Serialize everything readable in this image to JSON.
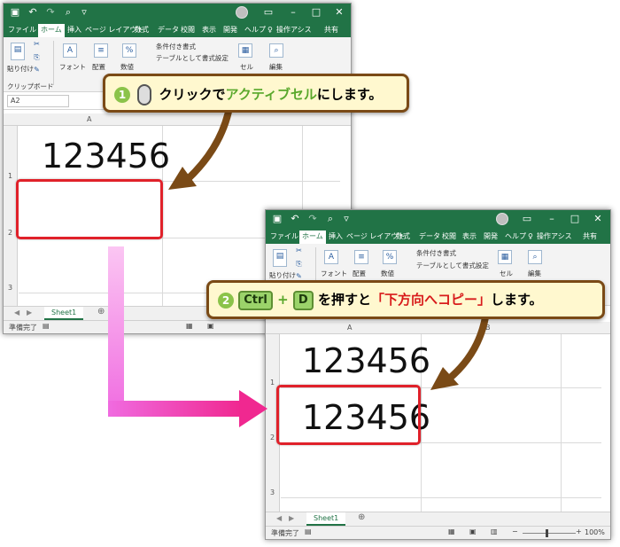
{
  "back_window": {
    "tabs": [
      "ファイル",
      "ホーム",
      "挿入",
      "ページ レイアウト",
      "数式",
      "データ",
      "校閲",
      "表示",
      "開発",
      "ヘルプ",
      "操作アシス",
      "共有"
    ],
    "ribbon": {
      "paste": "貼り付け",
      "font": "フォント",
      "align": "配置",
      "number": "数値",
      "cond_format": "条件付き書式",
      "table_format": "テーブルとして書式設定",
      "cells": "セル",
      "edit": "編集",
      "clipboard": "クリップボード"
    },
    "name_box": "A2",
    "col_a": "A",
    "rows": [
      "1",
      "2",
      "3"
    ],
    "a1_value": "123456",
    "sheet_tab": "Sheet1",
    "status": "準備完了"
  },
  "front_window": {
    "tabs": [
      "ファイル",
      "ホーム",
      "挿入",
      "ページ レイアウト",
      "数式",
      "データ",
      "校閲",
      "表示",
      "開発",
      "ヘルプ",
      "操作アシス",
      "共有"
    ],
    "ribbon": {
      "paste": "貼り付け",
      "font": "フォント",
      "align": "配置",
      "number": "数値",
      "cond_format": "条件付き書式",
      "table_format": "テーブルとして書式設定",
      "cells": "セル",
      "edit": "編集"
    },
    "col_a": "A",
    "col_b": "B",
    "rows": [
      "1",
      "2",
      "3"
    ],
    "a1_value": "123456",
    "a2_value": "123456",
    "sheet_tab": "Sheet1",
    "status": "準備完了",
    "zoom": "100%"
  },
  "callout1": {
    "num": "1",
    "t1": "クリックで",
    "t2": "アクティブセル",
    "t3": "にします。"
  },
  "callout2": {
    "num": "2",
    "key1": "Ctrl",
    "plus": "+",
    "key2": "D",
    "t1": "を押すと",
    "t2": "「下方向へコピー」",
    "t3": "します。"
  },
  "colors": {
    "excel_green": "#217346",
    "highlight_red": "#e0212a",
    "callout_border": "#7a4a16",
    "arrow_pink": "#f06be0"
  }
}
